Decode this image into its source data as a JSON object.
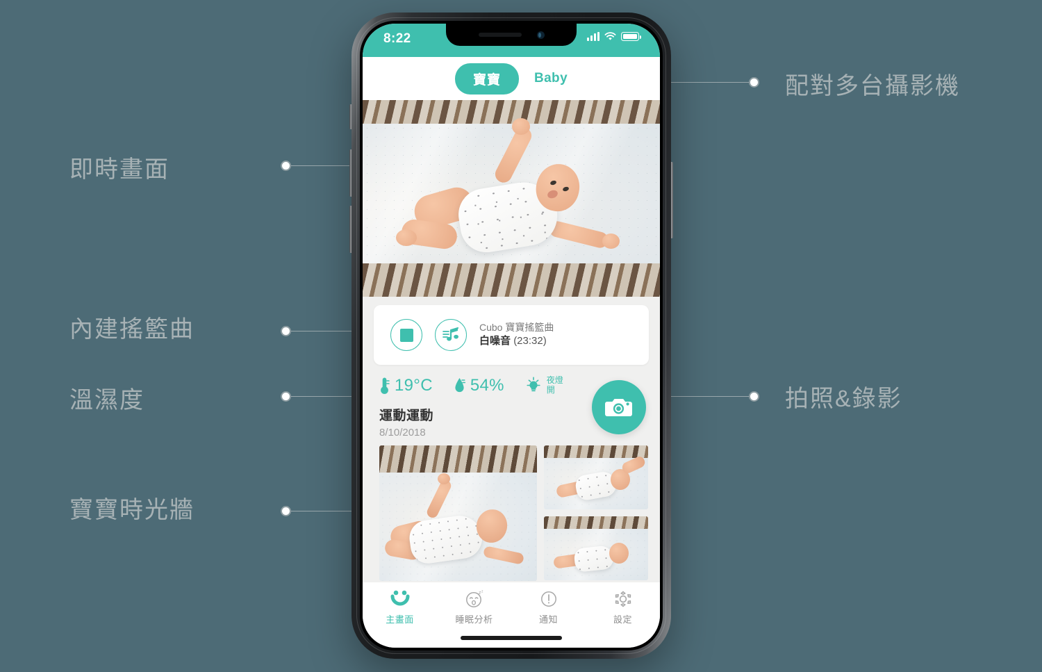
{
  "background_color": "#4d6b76",
  "accent_color": "#3fbfae",
  "annotations": {
    "left": [
      {
        "label": "即時畫面",
        "name": "annotation-live-view"
      },
      {
        "label": "內建搖籃曲",
        "name": "annotation-lullaby"
      },
      {
        "label": "溫濕度",
        "name": "annotation-temp-humidity"
      },
      {
        "label": "寶寶時光牆",
        "name": "annotation-timeline-wall"
      }
    ],
    "right": [
      {
        "label": "配對多台攝影機",
        "name": "annotation-multi-camera"
      },
      {
        "label": "拍照&錄影",
        "name": "annotation-photo-video"
      }
    ]
  },
  "phone": {
    "status_bar": {
      "time": "8:22",
      "signal_icon": "signal-bars-icon",
      "wifi_icon": "wifi-icon",
      "battery_icon": "battery-full-icon"
    },
    "top_tabs": {
      "active_label": "寶寶",
      "inactive_label": "Baby"
    },
    "live_view": {
      "name": "live-camera-feed"
    },
    "music_player": {
      "stop_icon": "stop-icon",
      "note_icon": "music-note-icon",
      "playlist": "Cubo 寶寶搖籃曲",
      "track_name": "白噪音",
      "track_time": "(23:32)"
    },
    "sensors": {
      "temperature_icon": "thermometer-icon",
      "temperature": "19°C",
      "humidity_icon": "humidity-drop-icon",
      "humidity": "54%",
      "nightlight_icon": "lightbulb-icon",
      "nightlight_label": "夜燈",
      "nightlight_state": "開"
    },
    "capture_button": {
      "icon": "camera-icon",
      "name": "capture-photo-button"
    },
    "gallery": {
      "title": "運動運動",
      "date": "8/10/2018"
    },
    "bottom_nav": [
      {
        "label": "主畫面",
        "icon": "home-smiley-icon",
        "active": true
      },
      {
        "label": "睡眠分析",
        "icon": "sleep-face-icon",
        "active": false
      },
      {
        "label": "通知",
        "icon": "alert-icon",
        "active": false
      },
      {
        "label": "設定",
        "icon": "gear-icon",
        "active": false
      }
    ]
  }
}
